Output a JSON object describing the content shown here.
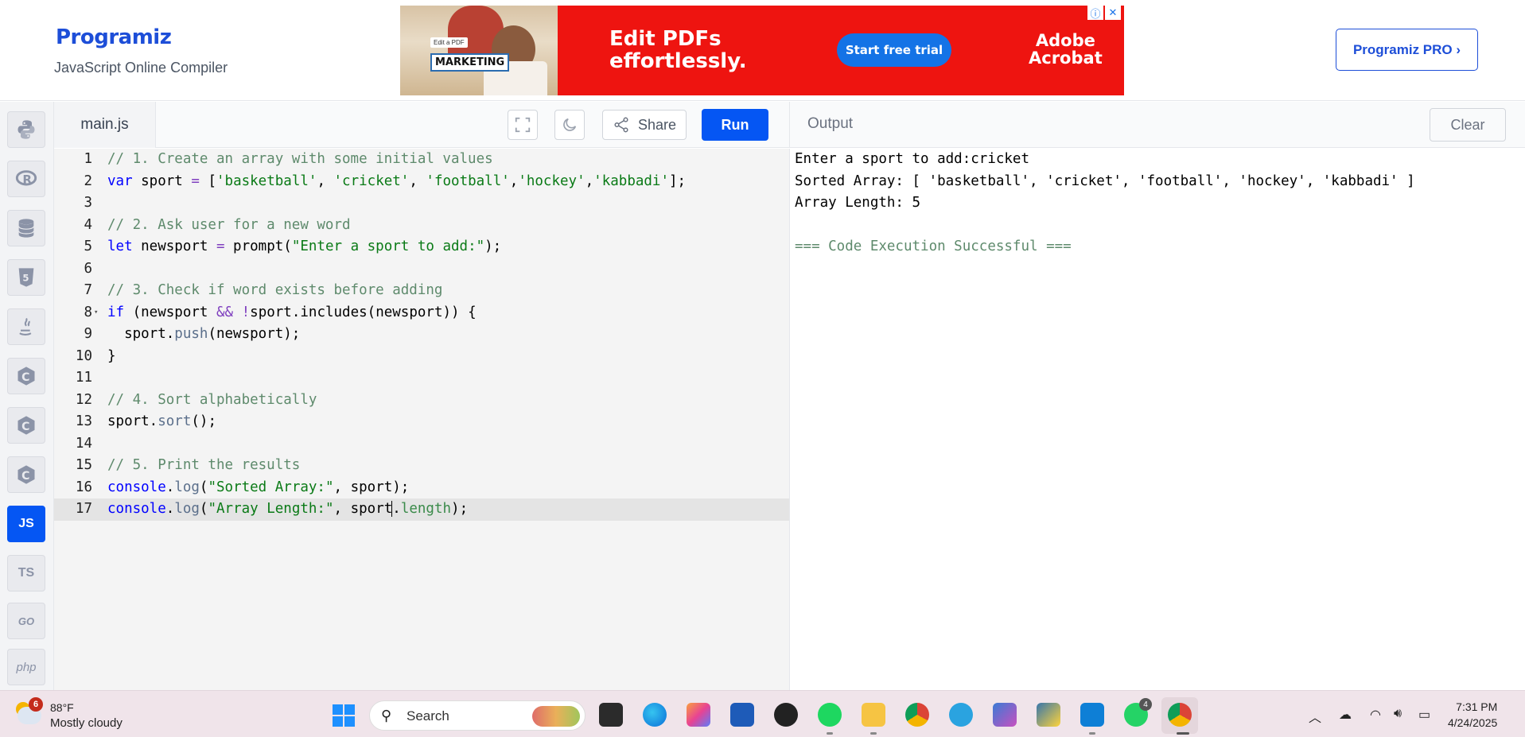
{
  "header": {
    "logo_text": "Programiz",
    "subtitle": "JavaScript Online Compiler",
    "pro_button": "Programiz PRO ›"
  },
  "ad": {
    "badge_small": "Edit a PDF",
    "badge": "MARKETING",
    "headline_1": "Edit PDFs",
    "headline_2": "effortlessly.",
    "cta": "Start free trial",
    "brand_1": "Adobe",
    "brand_2": "Acrobat",
    "info_glyph": "ⓘ",
    "close_glyph": "✕"
  },
  "sidebar": {
    "languages": [
      {
        "name": "python-icon",
        "label": ""
      },
      {
        "name": "r-icon",
        "label": "R"
      },
      {
        "name": "sql-icon",
        "label": ""
      },
      {
        "name": "html-icon",
        "label": "5"
      },
      {
        "name": "java-icon",
        "label": ""
      },
      {
        "name": "c-icon",
        "label": "C"
      },
      {
        "name": "cpp-icon",
        "label": "C"
      },
      {
        "name": "csharp-icon",
        "label": "C"
      },
      {
        "name": "js-icon",
        "label": "JS",
        "active": true
      },
      {
        "name": "ts-icon",
        "label": "TS"
      },
      {
        "name": "go-icon",
        "label": "GO"
      },
      {
        "name": "php-icon",
        "label": "php"
      }
    ]
  },
  "editor": {
    "tab": "main.js",
    "share_label": "Share",
    "run_label": "Run",
    "lines": [
      "1",
      "2",
      "3",
      "4",
      "5",
      "6",
      "7",
      "8",
      "9",
      "10",
      "11",
      "12",
      "13",
      "14",
      "15",
      "16",
      "17"
    ]
  },
  "output": {
    "title": "Output",
    "clear_label": "Clear",
    "lines": [
      "Enter a sport to add:cricket",
      "Sorted Array: [ 'basketball', 'cricket', 'football', 'hockey', 'kabbadi' ]",
      "Array Length: 5",
      "",
      "=== Code Execution Successful ==="
    ]
  },
  "taskbar": {
    "weather_badge": "6",
    "weather_temp": "88°F",
    "weather_desc": "Mostly cloudy",
    "search_placeholder": "Search",
    "whatsapp_badge": "4",
    "time": "7:31 PM",
    "date": "4/24/2025"
  },
  "colors": {
    "accent": "#0556f3",
    "ad_red": "#ee1410",
    "comment": "#5e8a6c",
    "string": "#0a7a16",
    "keyword": "#0000ff"
  }
}
